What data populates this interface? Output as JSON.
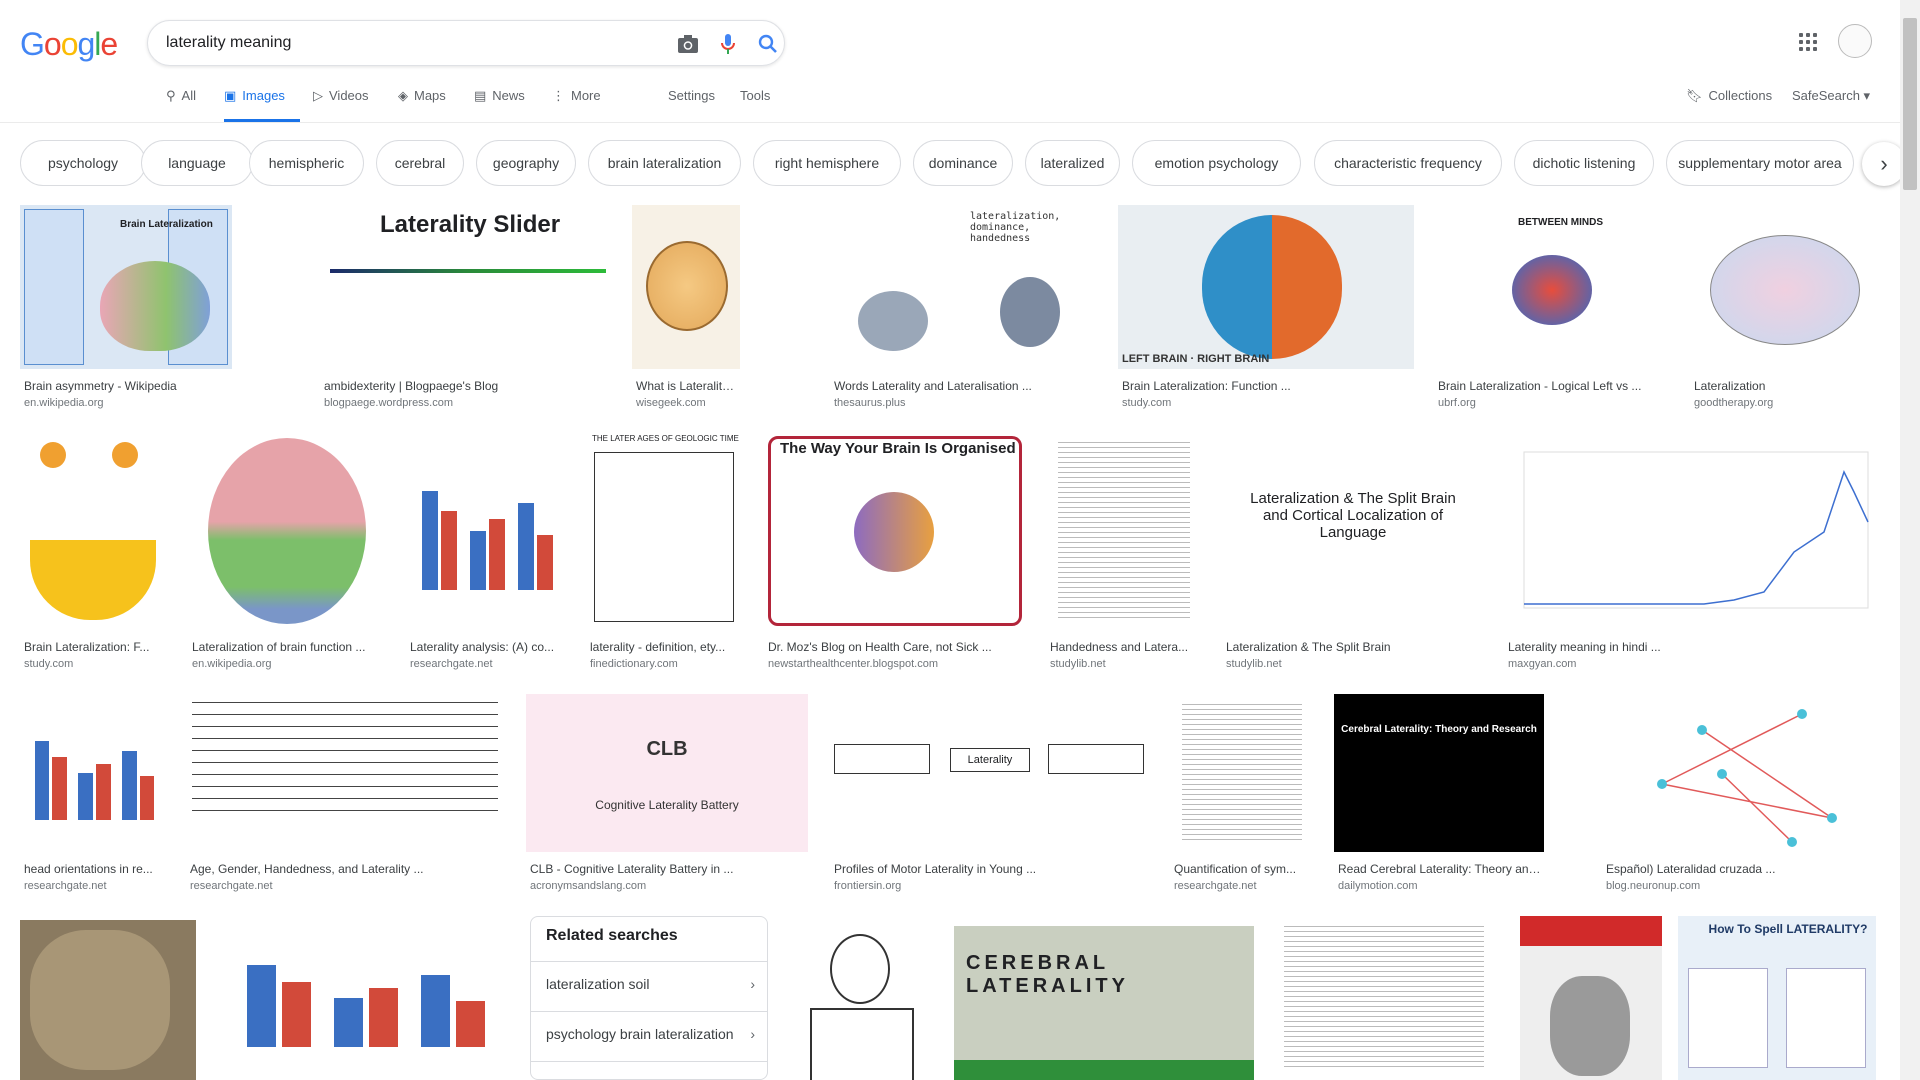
{
  "logo": {
    "letters": [
      "G",
      "o",
      "o",
      "g",
      "l",
      "e"
    ],
    "colors": [
      "#4285F4",
      "#EA4335",
      "#FBBC05",
      "#4285F4",
      "#34A853",
      "#EA4335"
    ]
  },
  "search": {
    "query": "laterality meaning"
  },
  "tabs": [
    {
      "label": "All",
      "icon": "search-icon"
    },
    {
      "label": "Images",
      "icon": "image-icon"
    },
    {
      "label": "Videos",
      "icon": "video-icon"
    },
    {
      "label": "Maps",
      "icon": "map-pin-icon"
    },
    {
      "label": "News",
      "icon": "news-icon"
    },
    {
      "label": "More",
      "icon": "kebab-icon"
    },
    {
      "label": "Settings"
    },
    {
      "label": "Tools"
    }
  ],
  "right_links": {
    "collections": "Collections",
    "safesearch": "SafeSearch ▾"
  },
  "chips": [
    "psychology",
    "language",
    "hemispheric",
    "cerebral",
    "geography",
    "brain lateralization",
    "right hemisphere",
    "dominance",
    "lateralized",
    "emotion psychology",
    "characteristic frequency",
    "dichotic listening",
    "supplementary motor area"
  ],
  "results": [
    {
      "title": "Brain asymmetry - Wikipedia",
      "source": "en.wikipedia.org",
      "thumb_text": "Brain Lateralization"
    },
    {
      "title": "ambidexterity | Blogpaege's Blog",
      "source": "blogpaege.wordpress.com",
      "thumb_text": "Laterality Slider"
    },
    {
      "title": "What is Laterality? (with pict...",
      "source": "wisegeek.com",
      "thumb_text": ""
    },
    {
      "title": "Words Laterality and Lateralisation ...",
      "source": "thesaurus.plus",
      "thumb_text": "lateralization, dominance, handedness"
    },
    {
      "title": "Brain Lateralization: Function ...",
      "source": "study.com",
      "thumb_text": "LEFT BRAIN · RIGHT BRAIN"
    },
    {
      "title": "Brain Lateralization - Logical Left vs ...",
      "source": "ubrf.org",
      "thumb_text": "BETWEEN MINDS"
    },
    {
      "title": "Lateralization",
      "source": "goodtherapy.org",
      "thumb_text": ""
    },
    {
      "title": "Brain Lateralization: F...",
      "source": "study.com",
      "thumb_text": ""
    },
    {
      "title": "Lateralization of brain function ...",
      "source": "en.wikipedia.org",
      "thumb_text": ""
    },
    {
      "title": "Laterality analysis: (A) co...",
      "source": "researchgate.net",
      "thumb_text": ""
    },
    {
      "title": "laterality - definition, ety...",
      "source": "finedictionary.com",
      "thumb_text": "THE LATER AGES OF GEOLOGIC TIME"
    },
    {
      "title": "Dr. Moz's Blog on Health Care, not Sick ...",
      "source": "newstarthealthcenter.blogspot.com",
      "thumb_text": "The Way Your Brain Is Organised"
    },
    {
      "title": "Handedness and Latera...",
      "source": "studylib.net",
      "thumb_text": ""
    },
    {
      "title": "Lateralization & The Split Brain",
      "source": "studylib.net",
      "thumb_text": "Lateralization & The Split Brain and Cortical Localization of Language"
    },
    {
      "title": "Laterality meaning in hindi ...",
      "source": "maxgyan.com",
      "thumb_text": ""
    },
    {
      "title": "head orientations in re...",
      "source": "researchgate.net",
      "thumb_text": ""
    },
    {
      "title": "Age, Gender, Handedness, and Laterality ...",
      "source": "researchgate.net",
      "thumb_text": ""
    },
    {
      "title": "CLB - Cognitive Laterality Battery in ...",
      "source": "acronymsandslang.com",
      "thumb_text": "CLB"
    },
    {
      "title": "Profiles of Motor Laterality in Young ...",
      "source": "frontiersin.org",
      "thumb_text": "Laterality"
    },
    {
      "title": "Quantification of sym...",
      "source": "researchgate.net",
      "thumb_text": ""
    },
    {
      "title": "Read Cerebral Laterality: Theory and ...",
      "source": "dailymotion.com",
      "thumb_text": "Cerebral Laterality: Theory and Research"
    },
    {
      "title": "Español) Lateralidad cruzada ...",
      "source": "blog.neuronup.com",
      "thumb_text": ""
    },
    {
      "title": "",
      "source": "",
      "thumb_text": ""
    },
    {
      "title": "",
      "source": "",
      "thumb_text": ""
    },
    {
      "title": "",
      "source": "",
      "thumb_text": ""
    },
    {
      "title": "",
      "source": "",
      "thumb_text": "CEREBRAL LATERALITY"
    },
    {
      "title": "",
      "source": "",
      "thumb_text": ""
    },
    {
      "title": "",
      "source": "",
      "thumb_text": ""
    },
    {
      "title": "",
      "source": "",
      "thumb_text": "How To Spell LATERALITY?"
    }
  ],
  "related": {
    "heading": "Related searches",
    "items": [
      "lateralization soil",
      "psychology brain lateralization"
    ]
  }
}
